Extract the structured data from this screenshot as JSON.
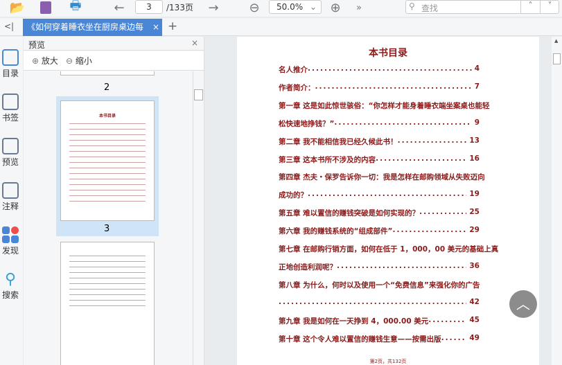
{
  "toolbar": {
    "page_current": "3",
    "page_total": "/133页",
    "zoom": "50.0%",
    "search_placeholder": "查找",
    "more": "»"
  },
  "tab": {
    "title": "《如何穿着睡衣坐在厨房桌边每",
    "add": "+",
    "close": "×",
    "collapse": "<|"
  },
  "leftbar": [
    {
      "label": "目录"
    },
    {
      "label": "书签"
    },
    {
      "label": "预览"
    },
    {
      "label": "注释"
    },
    {
      "label": "发现"
    },
    {
      "label": "搜索"
    }
  ],
  "preview": {
    "title": "预览",
    "close": "×",
    "zoom_in": "放大",
    "zoom_out": "缩小",
    "pages": [
      "2",
      "3"
    ]
  },
  "document": {
    "title": "本书目录",
    "footer": "第2页，共132页",
    "entries": [
      {
        "text": "名人推介",
        "page": "4"
      },
      {
        "text": "作者简介：",
        "page": "7"
      },
      {
        "text": "第一章  这是如此惊世骇俗：“你怎样才能身着睡衣端坐案桌也能轻",
        "page": ""
      },
      {
        "text": "松快速地挣钱？”",
        "page": "9"
      },
      {
        "text": "第二章  我不能相信我已经久候此书！",
        "page": "13"
      },
      {
        "text": "第三章    这本书所不涉及的内容",
        "page": "16"
      },
      {
        "text": "第四章  杰夫・保罗告诉你一切：我是怎样在邮购领域从失败迈向",
        "page": ""
      },
      {
        "text": "成功的？",
        "page": "19"
      },
      {
        "text": "第五章  难以置信的赚钱突破是如何实现的？",
        "page": "25"
      },
      {
        "text": "第六章    我的赚钱系统的“组成部件”",
        "page": "29"
      },
      {
        "text": "第七章  在邮购行销方面，如何在低于 1，000，00 美元的基础上真",
        "page": ""
      },
      {
        "text": "正地创造利润呢？",
        "page": "36"
      },
      {
        "text": "第八章  为什么，何时以及使用一个“免费信息”来强化你的广告",
        "page": ""
      },
      {
        "text": "",
        "page": "42"
      },
      {
        "text": "第九章  我是如何在一天挣到 4，000.00 美元",
        "page": "45"
      },
      {
        "text": "第十章    这个令人难以置信的赚钱生意——按需出版",
        "page": "49"
      }
    ]
  },
  "colors": {
    "accent": "#4a86d6",
    "toc": "#8b1a1a"
  }
}
